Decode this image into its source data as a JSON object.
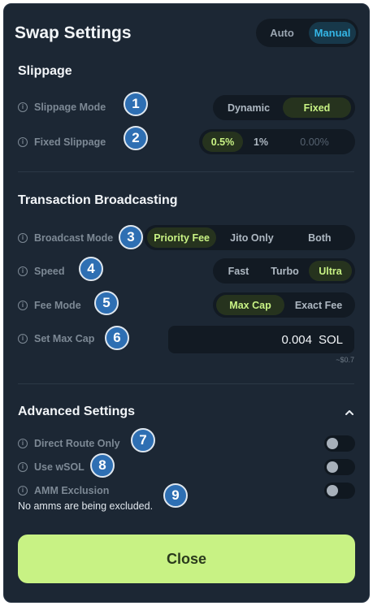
{
  "header": {
    "title": "Swap Settings",
    "modes": [
      "Auto",
      "Manual"
    ],
    "selected_mode": "Manual"
  },
  "slippage": {
    "title": "Slippage",
    "mode_label": "Slippage Mode",
    "mode_options": [
      "Dynamic",
      "Fixed"
    ],
    "mode_selected": "Fixed",
    "fixed_label": "Fixed Slippage",
    "fixed_options": [
      "0.5%",
      "1%"
    ],
    "fixed_selected": "0.5%",
    "custom_placeholder": "0.00%"
  },
  "broadcast": {
    "title": "Transaction Broadcasting",
    "mode_label": "Broadcast Mode",
    "mode_options": [
      "Priority Fee",
      "Jito Only",
      "Both"
    ],
    "mode_selected": "Priority Fee",
    "speed_label": "Speed",
    "speed_options": [
      "Fast",
      "Turbo",
      "Ultra"
    ],
    "speed_selected": "Ultra",
    "fee_label": "Fee Mode",
    "fee_options": [
      "Max Cap",
      "Exact Fee"
    ],
    "fee_selected": "Max Cap",
    "maxcap_label": "Set Max Cap",
    "maxcap_value": "0.004",
    "maxcap_unit": "SOL",
    "maxcap_usd": "~$0.7"
  },
  "advanced": {
    "title": "Advanced Settings",
    "direct_route_label": "Direct Route Only",
    "direct_route_on": false,
    "wsol_label": "Use wSOL",
    "wsol_on": false,
    "amm_label": "AMM Exclusion",
    "amm_on": false,
    "amm_note": "No amms are being excluded."
  },
  "badges": [
    "1",
    "2",
    "3",
    "4",
    "5",
    "6",
    "7",
    "8",
    "9"
  ],
  "close_label": "Close",
  "icons": {
    "info": "info-icon",
    "chevron": "chevron-up-icon"
  },
  "colors": {
    "accent": "#c8f284",
    "manual": "#34b6e6",
    "panel": "#1c2734",
    "badge": "#2e6fb3"
  }
}
